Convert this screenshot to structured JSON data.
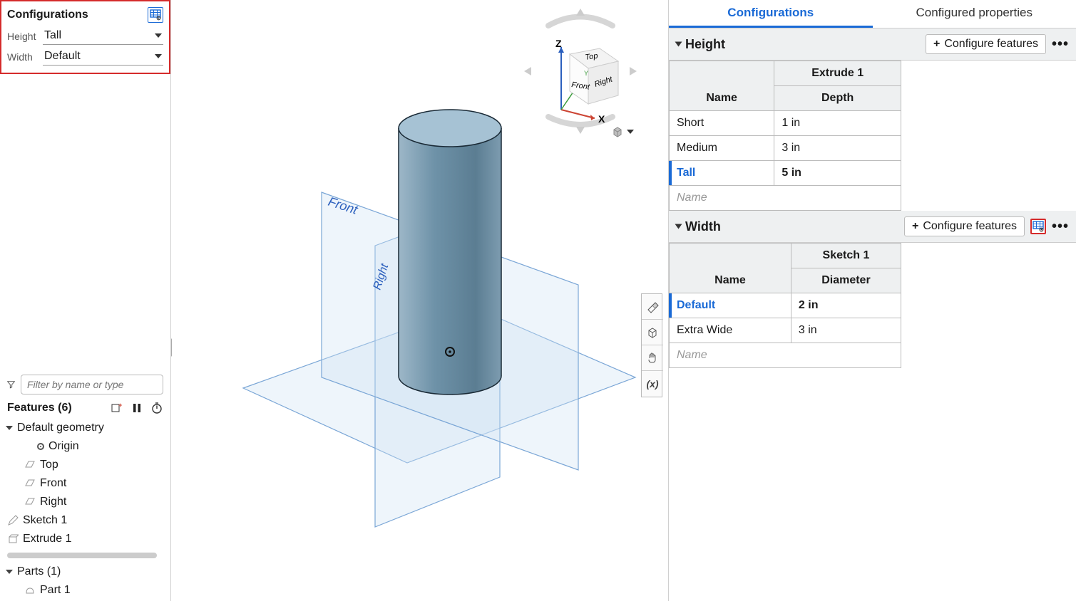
{
  "leftPanel": {
    "title": "Configurations",
    "rows": [
      {
        "label": "Height",
        "value": "Tall"
      },
      {
        "label": "Width",
        "value": "Default"
      }
    ],
    "filterPlaceholder": "Filter by name or type",
    "featuresTitle": "Features (6)",
    "tree": {
      "defaultGeometry": "Default geometry",
      "origin": "Origin",
      "top": "Top",
      "front": "Front",
      "right": "Right",
      "sketch": "Sketch 1",
      "extrude": "Extrude 1",
      "partsTitle": "Parts (1)",
      "part": "Part 1"
    }
  },
  "viewport": {
    "cubeFaces": {
      "top": "Top",
      "front": "Front",
      "right": "Right"
    },
    "axes": {
      "x": "X",
      "z": "Z"
    },
    "planeFront": "Front",
    "planeRight": "Right"
  },
  "rightPanel": {
    "tabs": {
      "config": "Configurations",
      "props": "Configured properties"
    },
    "configureButton": "Configure features",
    "sections": [
      {
        "title": "Height",
        "group": "Extrude 1",
        "col1": "Name",
        "col2": "Depth",
        "rows": [
          {
            "name": "Short",
            "val": "1 in",
            "active": false
          },
          {
            "name": "Medium",
            "val": "3 in",
            "active": false
          },
          {
            "name": "Tall",
            "val": "5 in",
            "active": true
          }
        ],
        "placeholder": "Name",
        "hasRedIcon": false
      },
      {
        "title": "Width",
        "group": "Sketch 1",
        "col1": "Name",
        "col2": "Diameter",
        "rows": [
          {
            "name": "Default",
            "val": "2 in",
            "active": true
          },
          {
            "name": "Extra Wide",
            "val": "3 in",
            "active": false
          }
        ],
        "placeholder": "Name",
        "hasRedIcon": true
      }
    ]
  }
}
